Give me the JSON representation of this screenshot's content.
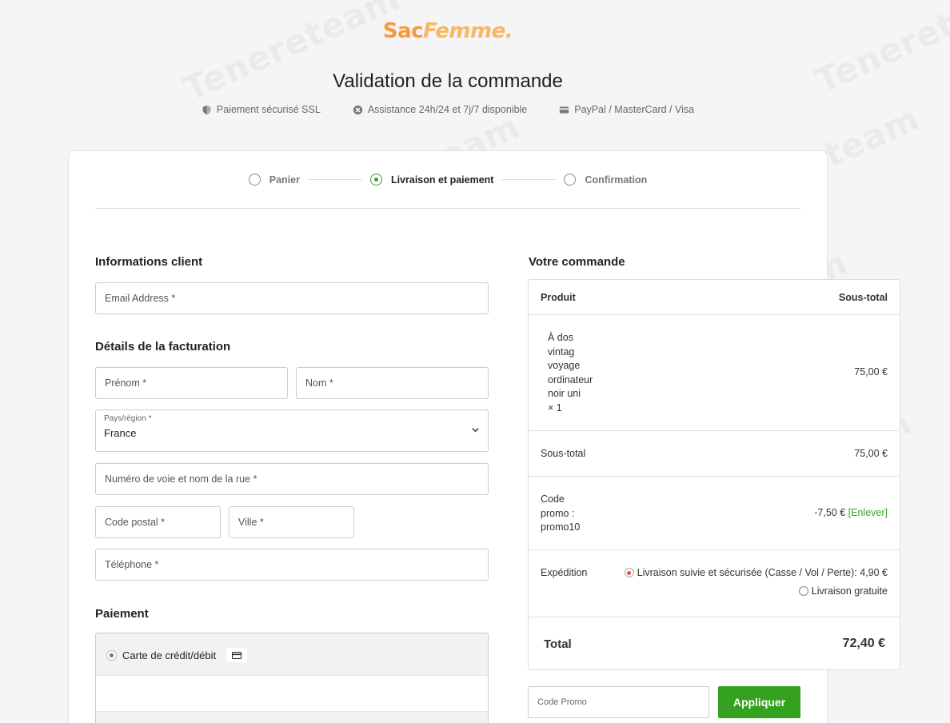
{
  "brand": {
    "logo_part1": "Sac",
    "logo_part2": "Femme."
  },
  "page_title": "Validation de la commande",
  "trust": [
    {
      "icon": "shield-icon",
      "label": "Paiement sécurisé SSL"
    },
    {
      "icon": "support-icon",
      "label": "Assistance 24h/24 et 7j/7 disponible"
    },
    {
      "icon": "credit-card-icon",
      "label": "PayPal / MasterCard / Visa"
    }
  ],
  "steps": {
    "items": [
      {
        "label": "Panier",
        "active": false
      },
      {
        "label": "Livraison et paiement",
        "active": true
      },
      {
        "label": "Confirmation",
        "active": false
      }
    ]
  },
  "customer": {
    "title": "Informations client",
    "email_placeholder": "Email Address *"
  },
  "billing": {
    "title": "Détails de la facturation",
    "first_name_placeholder": "Prénom *",
    "last_name_placeholder": "Nom *",
    "country_label": "Pays/région",
    "country_required": "*",
    "country_value": "France",
    "street_placeholder": "Numéro de voie et nom de la rue *",
    "postcode_placeholder": "Code postal *",
    "city_placeholder": "Ville *",
    "phone_placeholder": "Téléphone *"
  },
  "payment": {
    "title": "Paiement",
    "method_label": "Carte de crédit/débit"
  },
  "order": {
    "title": "Votre commande",
    "col_product": "Produit",
    "col_subtotal": "Sous-total",
    "product_lines": [
      "À dos",
      "vintag",
      "voyage",
      "ordinateur",
      "noir uni",
      "× 1"
    ],
    "product_price": "75,00 €",
    "subtotal_label": "Sous-total",
    "subtotal_value": "75,00 €",
    "promo_lines": [
      "Code",
      "promo :",
      "promo10"
    ],
    "promo_value": "-7,50 €",
    "promo_remove": "[Enlever]",
    "shipping_label": "Expédition",
    "shipping_option1": "Livraison suivie et sécurisée (Casse / Vol / Perte): 4,90 €",
    "shipping_option2": "Livraison gratuite",
    "total_label": "Total",
    "total_value": "72,40 €"
  },
  "promo": {
    "placeholder": "Code Promo",
    "apply_label": "Appliquer"
  },
  "watermark": "Tenereteam",
  "colors": {
    "accent_green": "#34a11f",
    "logo_orange": "#f49a3a"
  }
}
